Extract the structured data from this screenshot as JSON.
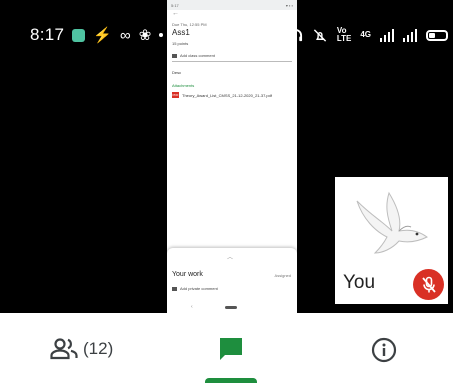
{
  "status_bar": {
    "time": "8:17",
    "lte_label_top": "Vo",
    "lte_label_bottom": "LTE",
    "network_label": "4G"
  },
  "shared_screen": {
    "mini_time": "5:17",
    "due": "Due Thu, 12:55 PM",
    "title": "Ass1",
    "points": "15 points",
    "class_comment": "Add class comment",
    "description": "Desc",
    "attachments_header": "Attachments",
    "attachment_file": "Theory_Award_List_CMSS_21-12-2020_21-37.pdf",
    "pdf_badge": "PDF",
    "your_work": "Your work",
    "assigned": "Assigned",
    "private_comment": "Add private comment"
  },
  "self_view": {
    "label": "You",
    "mic_state": "muted"
  },
  "bottom_nav": {
    "participants_count": "(12)",
    "items": [
      "people-icon",
      "chat-icon",
      "info-icon"
    ],
    "active": "chat",
    "accent_color": "#1e8e3e"
  },
  "colors": {
    "mic_off": "#d93025",
    "accent": "#1e8e3e"
  }
}
